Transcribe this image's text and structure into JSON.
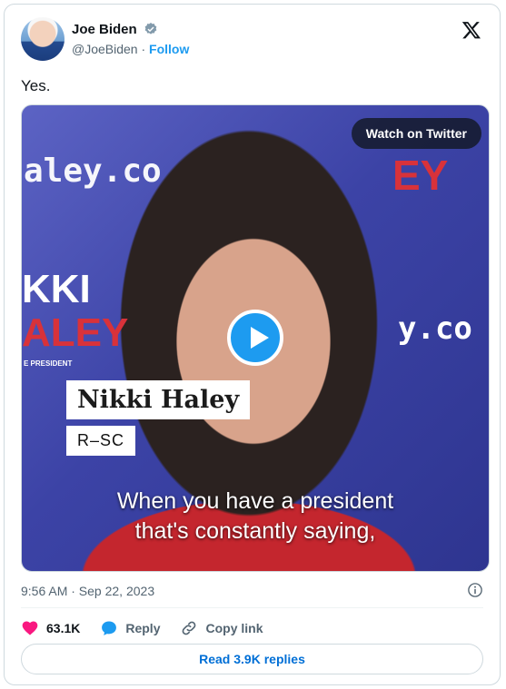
{
  "author": {
    "name": "Joe Biden",
    "handle": "@JoeBiden",
    "follow_label": "Follow",
    "verified": true
  },
  "tweet": {
    "text": "Yes."
  },
  "media": {
    "watch_label": "Watch on Twitter",
    "lower_third_name": "Nikki Haley",
    "lower_third_title": "R–SC",
    "caption_line1": "When you have a president",
    "caption_line2": "that's constantly saying,",
    "background_text": {
      "url_left": "aley.co",
      "url_right": "y.co",
      "nikki": "KKI",
      "haley_left": "ALEY",
      "haley_right": "EY",
      "president": "E PRESIDENT"
    }
  },
  "meta": {
    "timestamp": "9:56 AM · Sep 22, 2023"
  },
  "actions": {
    "likes": "63.1K",
    "reply_label": "Reply",
    "copy_label": "Copy link"
  },
  "read_replies_label": "Read 3.9K replies",
  "colors": {
    "accent": "#1d9bf0",
    "like": "#f91880",
    "text": "#0f1419",
    "muted": "#536471"
  }
}
